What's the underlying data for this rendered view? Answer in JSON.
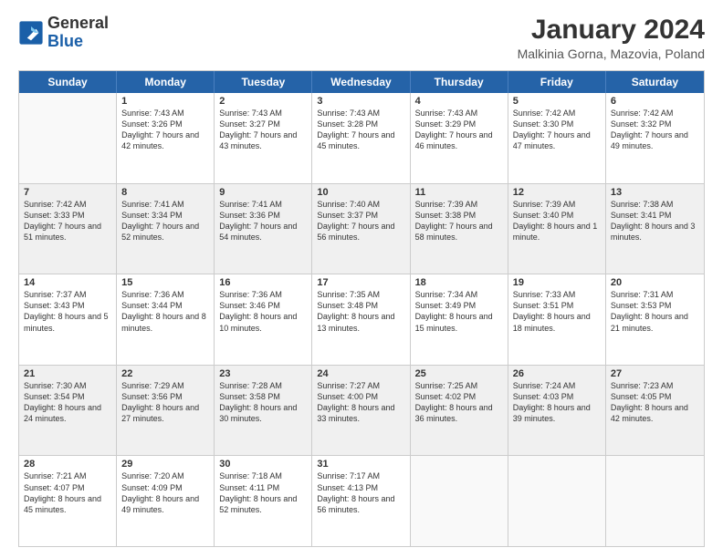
{
  "logo": {
    "line1": "General",
    "line2": "Blue"
  },
  "title": "January 2024",
  "subtitle": "Malkinia Gorna, Mazovia, Poland",
  "header_days": [
    "Sunday",
    "Monday",
    "Tuesday",
    "Wednesday",
    "Thursday",
    "Friday",
    "Saturday"
  ],
  "weeks": [
    [
      {
        "day": "",
        "sunrise": "",
        "sunset": "",
        "daylight": "",
        "shaded": false,
        "empty": true
      },
      {
        "day": "1",
        "sunrise": "Sunrise: 7:43 AM",
        "sunset": "Sunset: 3:26 PM",
        "daylight": "Daylight: 7 hours and 42 minutes.",
        "shaded": false,
        "empty": false
      },
      {
        "day": "2",
        "sunrise": "Sunrise: 7:43 AM",
        "sunset": "Sunset: 3:27 PM",
        "daylight": "Daylight: 7 hours and 43 minutes.",
        "shaded": false,
        "empty": false
      },
      {
        "day": "3",
        "sunrise": "Sunrise: 7:43 AM",
        "sunset": "Sunset: 3:28 PM",
        "daylight": "Daylight: 7 hours and 45 minutes.",
        "shaded": false,
        "empty": false
      },
      {
        "day": "4",
        "sunrise": "Sunrise: 7:43 AM",
        "sunset": "Sunset: 3:29 PM",
        "daylight": "Daylight: 7 hours and 46 minutes.",
        "shaded": false,
        "empty": false
      },
      {
        "day": "5",
        "sunrise": "Sunrise: 7:42 AM",
        "sunset": "Sunset: 3:30 PM",
        "daylight": "Daylight: 7 hours and 47 minutes.",
        "shaded": false,
        "empty": false
      },
      {
        "day": "6",
        "sunrise": "Sunrise: 7:42 AM",
        "sunset": "Sunset: 3:32 PM",
        "daylight": "Daylight: 7 hours and 49 minutes.",
        "shaded": false,
        "empty": false
      }
    ],
    [
      {
        "day": "7",
        "sunrise": "Sunrise: 7:42 AM",
        "sunset": "Sunset: 3:33 PM",
        "daylight": "Daylight: 7 hours and 51 minutes.",
        "shaded": true,
        "empty": false
      },
      {
        "day": "8",
        "sunrise": "Sunrise: 7:41 AM",
        "sunset": "Sunset: 3:34 PM",
        "daylight": "Daylight: 7 hours and 52 minutes.",
        "shaded": true,
        "empty": false
      },
      {
        "day": "9",
        "sunrise": "Sunrise: 7:41 AM",
        "sunset": "Sunset: 3:36 PM",
        "daylight": "Daylight: 7 hours and 54 minutes.",
        "shaded": true,
        "empty": false
      },
      {
        "day": "10",
        "sunrise": "Sunrise: 7:40 AM",
        "sunset": "Sunset: 3:37 PM",
        "daylight": "Daylight: 7 hours and 56 minutes.",
        "shaded": true,
        "empty": false
      },
      {
        "day": "11",
        "sunrise": "Sunrise: 7:39 AM",
        "sunset": "Sunset: 3:38 PM",
        "daylight": "Daylight: 7 hours and 58 minutes.",
        "shaded": true,
        "empty": false
      },
      {
        "day": "12",
        "sunrise": "Sunrise: 7:39 AM",
        "sunset": "Sunset: 3:40 PM",
        "daylight": "Daylight: 8 hours and 1 minute.",
        "shaded": true,
        "empty": false
      },
      {
        "day": "13",
        "sunrise": "Sunrise: 7:38 AM",
        "sunset": "Sunset: 3:41 PM",
        "daylight": "Daylight: 8 hours and 3 minutes.",
        "shaded": true,
        "empty": false
      }
    ],
    [
      {
        "day": "14",
        "sunrise": "Sunrise: 7:37 AM",
        "sunset": "Sunset: 3:43 PM",
        "daylight": "Daylight: 8 hours and 5 minutes.",
        "shaded": false,
        "empty": false
      },
      {
        "day": "15",
        "sunrise": "Sunrise: 7:36 AM",
        "sunset": "Sunset: 3:44 PM",
        "daylight": "Daylight: 8 hours and 8 minutes.",
        "shaded": false,
        "empty": false
      },
      {
        "day": "16",
        "sunrise": "Sunrise: 7:36 AM",
        "sunset": "Sunset: 3:46 PM",
        "daylight": "Daylight: 8 hours and 10 minutes.",
        "shaded": false,
        "empty": false
      },
      {
        "day": "17",
        "sunrise": "Sunrise: 7:35 AM",
        "sunset": "Sunset: 3:48 PM",
        "daylight": "Daylight: 8 hours and 13 minutes.",
        "shaded": false,
        "empty": false
      },
      {
        "day": "18",
        "sunrise": "Sunrise: 7:34 AM",
        "sunset": "Sunset: 3:49 PM",
        "daylight": "Daylight: 8 hours and 15 minutes.",
        "shaded": false,
        "empty": false
      },
      {
        "day": "19",
        "sunrise": "Sunrise: 7:33 AM",
        "sunset": "Sunset: 3:51 PM",
        "daylight": "Daylight: 8 hours and 18 minutes.",
        "shaded": false,
        "empty": false
      },
      {
        "day": "20",
        "sunrise": "Sunrise: 7:31 AM",
        "sunset": "Sunset: 3:53 PM",
        "daylight": "Daylight: 8 hours and 21 minutes.",
        "shaded": false,
        "empty": false
      }
    ],
    [
      {
        "day": "21",
        "sunrise": "Sunrise: 7:30 AM",
        "sunset": "Sunset: 3:54 PM",
        "daylight": "Daylight: 8 hours and 24 minutes.",
        "shaded": true,
        "empty": false
      },
      {
        "day": "22",
        "sunrise": "Sunrise: 7:29 AM",
        "sunset": "Sunset: 3:56 PM",
        "daylight": "Daylight: 8 hours and 27 minutes.",
        "shaded": true,
        "empty": false
      },
      {
        "day": "23",
        "sunrise": "Sunrise: 7:28 AM",
        "sunset": "Sunset: 3:58 PM",
        "daylight": "Daylight: 8 hours and 30 minutes.",
        "shaded": true,
        "empty": false
      },
      {
        "day": "24",
        "sunrise": "Sunrise: 7:27 AM",
        "sunset": "Sunset: 4:00 PM",
        "daylight": "Daylight: 8 hours and 33 minutes.",
        "shaded": true,
        "empty": false
      },
      {
        "day": "25",
        "sunrise": "Sunrise: 7:25 AM",
        "sunset": "Sunset: 4:02 PM",
        "daylight": "Daylight: 8 hours and 36 minutes.",
        "shaded": true,
        "empty": false
      },
      {
        "day": "26",
        "sunrise": "Sunrise: 7:24 AM",
        "sunset": "Sunset: 4:03 PM",
        "daylight": "Daylight: 8 hours and 39 minutes.",
        "shaded": true,
        "empty": false
      },
      {
        "day": "27",
        "sunrise": "Sunrise: 7:23 AM",
        "sunset": "Sunset: 4:05 PM",
        "daylight": "Daylight: 8 hours and 42 minutes.",
        "shaded": true,
        "empty": false
      }
    ],
    [
      {
        "day": "28",
        "sunrise": "Sunrise: 7:21 AM",
        "sunset": "Sunset: 4:07 PM",
        "daylight": "Daylight: 8 hours and 45 minutes.",
        "shaded": false,
        "empty": false
      },
      {
        "day": "29",
        "sunrise": "Sunrise: 7:20 AM",
        "sunset": "Sunset: 4:09 PM",
        "daylight": "Daylight: 8 hours and 49 minutes.",
        "shaded": false,
        "empty": false
      },
      {
        "day": "30",
        "sunrise": "Sunrise: 7:18 AM",
        "sunset": "Sunset: 4:11 PM",
        "daylight": "Daylight: 8 hours and 52 minutes.",
        "shaded": false,
        "empty": false
      },
      {
        "day": "31",
        "sunrise": "Sunrise: 7:17 AM",
        "sunset": "Sunset: 4:13 PM",
        "daylight": "Daylight: 8 hours and 56 minutes.",
        "shaded": false,
        "empty": false
      },
      {
        "day": "",
        "sunrise": "",
        "sunset": "",
        "daylight": "",
        "shaded": false,
        "empty": true
      },
      {
        "day": "",
        "sunrise": "",
        "sunset": "",
        "daylight": "",
        "shaded": false,
        "empty": true
      },
      {
        "day": "",
        "sunrise": "",
        "sunset": "",
        "daylight": "",
        "shaded": false,
        "empty": true
      }
    ]
  ]
}
